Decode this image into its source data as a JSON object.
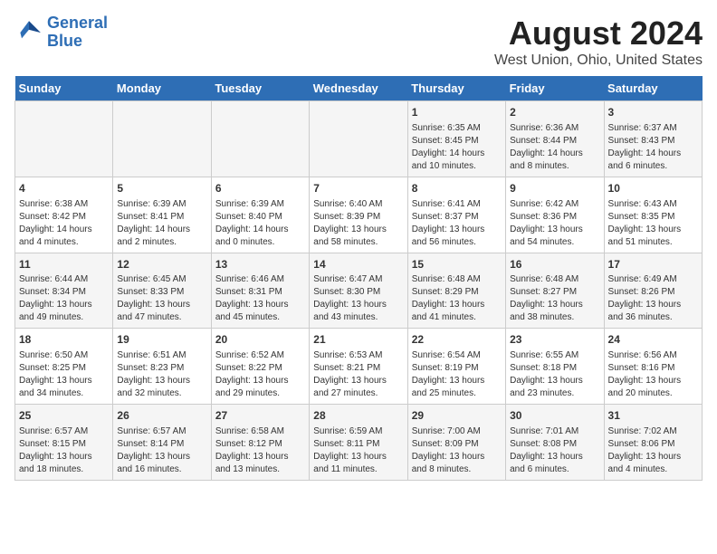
{
  "logo": {
    "line1": "General",
    "line2": "Blue"
  },
  "title": "August 2024",
  "subtitle": "West Union, Ohio, United States",
  "headers": [
    "Sunday",
    "Monday",
    "Tuesday",
    "Wednesday",
    "Thursday",
    "Friday",
    "Saturday"
  ],
  "weeks": [
    [
      {
        "day": "",
        "info": ""
      },
      {
        "day": "",
        "info": ""
      },
      {
        "day": "",
        "info": ""
      },
      {
        "day": "",
        "info": ""
      },
      {
        "day": "1",
        "info": "Sunrise: 6:35 AM\nSunset: 8:45 PM\nDaylight: 14 hours\nand 10 minutes."
      },
      {
        "day": "2",
        "info": "Sunrise: 6:36 AM\nSunset: 8:44 PM\nDaylight: 14 hours\nand 8 minutes."
      },
      {
        "day": "3",
        "info": "Sunrise: 6:37 AM\nSunset: 8:43 PM\nDaylight: 14 hours\nand 6 minutes."
      }
    ],
    [
      {
        "day": "4",
        "info": "Sunrise: 6:38 AM\nSunset: 8:42 PM\nDaylight: 14 hours\nand 4 minutes."
      },
      {
        "day": "5",
        "info": "Sunrise: 6:39 AM\nSunset: 8:41 PM\nDaylight: 14 hours\nand 2 minutes."
      },
      {
        "day": "6",
        "info": "Sunrise: 6:39 AM\nSunset: 8:40 PM\nDaylight: 14 hours\nand 0 minutes."
      },
      {
        "day": "7",
        "info": "Sunrise: 6:40 AM\nSunset: 8:39 PM\nDaylight: 13 hours\nand 58 minutes."
      },
      {
        "day": "8",
        "info": "Sunrise: 6:41 AM\nSunset: 8:37 PM\nDaylight: 13 hours\nand 56 minutes."
      },
      {
        "day": "9",
        "info": "Sunrise: 6:42 AM\nSunset: 8:36 PM\nDaylight: 13 hours\nand 54 minutes."
      },
      {
        "day": "10",
        "info": "Sunrise: 6:43 AM\nSunset: 8:35 PM\nDaylight: 13 hours\nand 51 minutes."
      }
    ],
    [
      {
        "day": "11",
        "info": "Sunrise: 6:44 AM\nSunset: 8:34 PM\nDaylight: 13 hours\nand 49 minutes."
      },
      {
        "day": "12",
        "info": "Sunrise: 6:45 AM\nSunset: 8:33 PM\nDaylight: 13 hours\nand 47 minutes."
      },
      {
        "day": "13",
        "info": "Sunrise: 6:46 AM\nSunset: 8:31 PM\nDaylight: 13 hours\nand 45 minutes."
      },
      {
        "day": "14",
        "info": "Sunrise: 6:47 AM\nSunset: 8:30 PM\nDaylight: 13 hours\nand 43 minutes."
      },
      {
        "day": "15",
        "info": "Sunrise: 6:48 AM\nSunset: 8:29 PM\nDaylight: 13 hours\nand 41 minutes."
      },
      {
        "day": "16",
        "info": "Sunrise: 6:48 AM\nSunset: 8:27 PM\nDaylight: 13 hours\nand 38 minutes."
      },
      {
        "day": "17",
        "info": "Sunrise: 6:49 AM\nSunset: 8:26 PM\nDaylight: 13 hours\nand 36 minutes."
      }
    ],
    [
      {
        "day": "18",
        "info": "Sunrise: 6:50 AM\nSunset: 8:25 PM\nDaylight: 13 hours\nand 34 minutes."
      },
      {
        "day": "19",
        "info": "Sunrise: 6:51 AM\nSunset: 8:23 PM\nDaylight: 13 hours\nand 32 minutes."
      },
      {
        "day": "20",
        "info": "Sunrise: 6:52 AM\nSunset: 8:22 PM\nDaylight: 13 hours\nand 29 minutes."
      },
      {
        "day": "21",
        "info": "Sunrise: 6:53 AM\nSunset: 8:21 PM\nDaylight: 13 hours\nand 27 minutes."
      },
      {
        "day": "22",
        "info": "Sunrise: 6:54 AM\nSunset: 8:19 PM\nDaylight: 13 hours\nand 25 minutes."
      },
      {
        "day": "23",
        "info": "Sunrise: 6:55 AM\nSunset: 8:18 PM\nDaylight: 13 hours\nand 23 minutes."
      },
      {
        "day": "24",
        "info": "Sunrise: 6:56 AM\nSunset: 8:16 PM\nDaylight: 13 hours\nand 20 minutes."
      }
    ],
    [
      {
        "day": "25",
        "info": "Sunrise: 6:57 AM\nSunset: 8:15 PM\nDaylight: 13 hours\nand 18 minutes."
      },
      {
        "day": "26",
        "info": "Sunrise: 6:57 AM\nSunset: 8:14 PM\nDaylight: 13 hours\nand 16 minutes."
      },
      {
        "day": "27",
        "info": "Sunrise: 6:58 AM\nSunset: 8:12 PM\nDaylight: 13 hours\nand 13 minutes."
      },
      {
        "day": "28",
        "info": "Sunrise: 6:59 AM\nSunset: 8:11 PM\nDaylight: 13 hours\nand 11 minutes."
      },
      {
        "day": "29",
        "info": "Sunrise: 7:00 AM\nSunset: 8:09 PM\nDaylight: 13 hours\nand 8 minutes."
      },
      {
        "day": "30",
        "info": "Sunrise: 7:01 AM\nSunset: 8:08 PM\nDaylight: 13 hours\nand 6 minutes."
      },
      {
        "day": "31",
        "info": "Sunrise: 7:02 AM\nSunset: 8:06 PM\nDaylight: 13 hours\nand 4 minutes."
      }
    ]
  ]
}
